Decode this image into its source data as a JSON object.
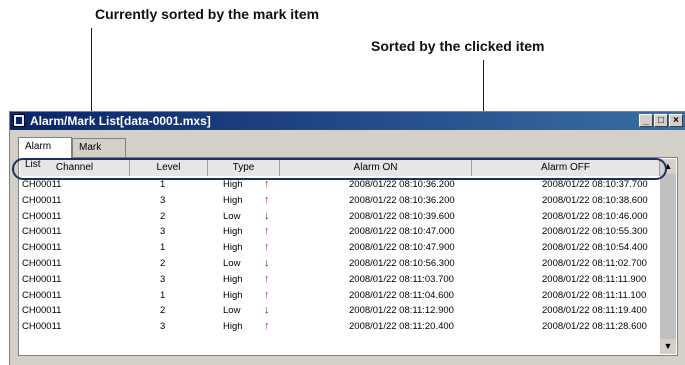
{
  "annotations": {
    "sorted_by_mark": "Currently sorted by the mark item",
    "sorted_by_clicked": "Sorted by the clicked item"
  },
  "window": {
    "title": "Alarm/Mark List[data-0001.mxs]",
    "controls": {
      "minimize": "_",
      "maximize": "□",
      "close": "×"
    }
  },
  "tabs": [
    {
      "label": "Alarm List",
      "active": true
    },
    {
      "label": "Mark List",
      "active": false
    }
  ],
  "table": {
    "columns": [
      "Channel",
      "Level",
      "Type",
      "Alarm ON",
      "Alarm OFF"
    ],
    "rows": [
      {
        "channel": "CH00011",
        "level": "1",
        "type": "High",
        "dir": "up",
        "on": "2008/01/22 08:10:36.200",
        "off": "2008/01/22 08:10:37.700"
      },
      {
        "channel": "CH00011",
        "level": "3",
        "type": "High",
        "dir": "up",
        "on": "2008/01/22 08:10:36.200",
        "off": "2008/01/22 08:10:38.600"
      },
      {
        "channel": "CH00011",
        "level": "2",
        "type": "Low",
        "dir": "down",
        "on": "2008/01/22 08:10:39.600",
        "off": "2008/01/22 08:10:46.000"
      },
      {
        "channel": "CH00011",
        "level": "3",
        "type": "High",
        "dir": "up",
        "on": "2008/01/22 08:10:47.000",
        "off": "2008/01/22 08:10:55.300"
      },
      {
        "channel": "CH00011",
        "level": "1",
        "type": "High",
        "dir": "up",
        "on": "2008/01/22 08:10:47.900",
        "off": "2008/01/22 08:10:54.400"
      },
      {
        "channel": "CH00011",
        "level": "2",
        "type": "Low",
        "dir": "down",
        "on": "2008/01/22 08:10:56.300",
        "off": "2008/01/22 08:11:02.700"
      },
      {
        "channel": "CH00011",
        "level": "3",
        "type": "High",
        "dir": "up",
        "on": "2008/01/22 08:11:03.700",
        "off": "2008/01/22 08:11:11.900"
      },
      {
        "channel": "CH00011",
        "level": "1",
        "type": "High",
        "dir": "up",
        "on": "2008/01/22 08:11:04.600",
        "off": "2008/01/22 08:11:11.100"
      },
      {
        "channel": "CH00011",
        "level": "2",
        "type": "Low",
        "dir": "down",
        "on": "2008/01/22 08:11:12.900",
        "off": "2008/01/22 08:11:19.400"
      },
      {
        "channel": "CH00011",
        "level": "3",
        "type": "High",
        "dir": "up",
        "on": "2008/01/22 08:11:20.400",
        "off": "2008/01/22 08:11:28.600"
      }
    ]
  },
  "scrollbar": {
    "up": "▲",
    "down": "▼"
  },
  "colors": {
    "up_arrow": "#e02020",
    "down_arrow": "#1030c0",
    "annotation_line": "#1e2f66"
  }
}
